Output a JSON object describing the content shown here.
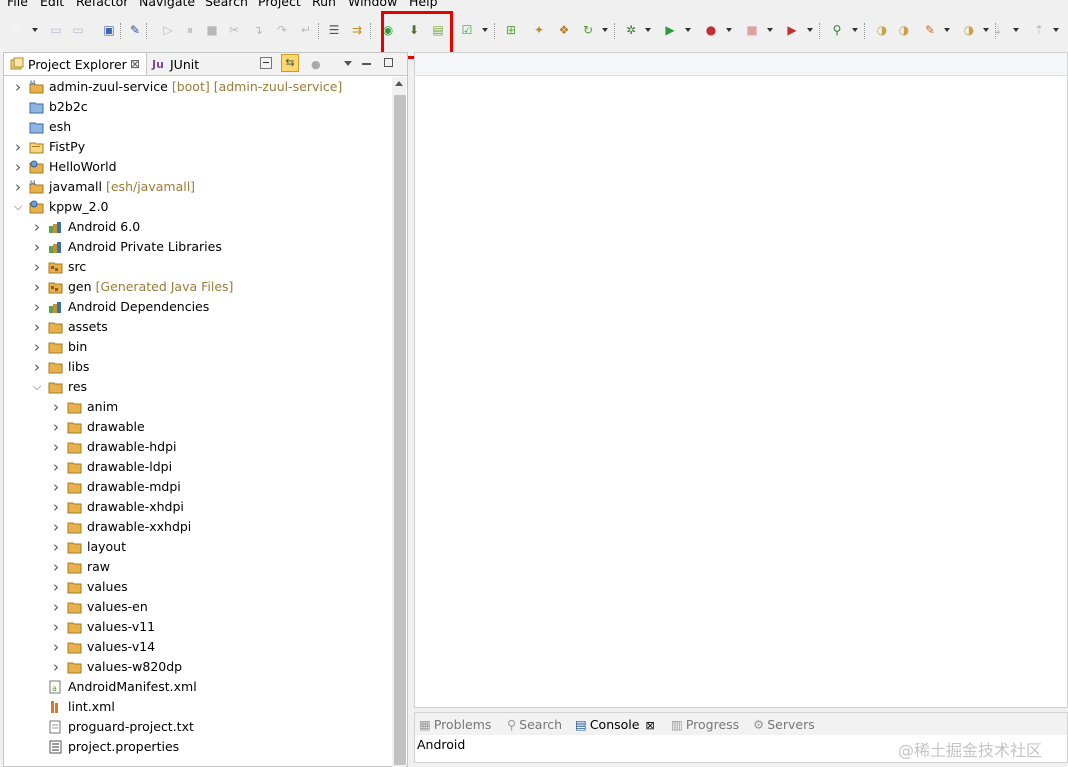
{
  "menu": [
    "File",
    "Edit",
    "Refactor",
    "Navigate",
    "Search",
    "Project",
    "Run",
    "Window",
    "Help"
  ],
  "explorer": {
    "tab_project_explorer": "Project Explorer",
    "tab_close_glyph": "⊠",
    "tab_junit": "JUnit",
    "tab_junit_prefix": "Ju"
  },
  "tree": [
    {
      "label": "admin-zuul-service",
      "deco": "[boot] [admin-zuul-service]",
      "icon": "maven-project-icon",
      "level": 0,
      "state": "collapsed"
    },
    {
      "label": "b2b2c",
      "deco": "",
      "icon": "closed-project-icon",
      "level": 0,
      "state": "none"
    },
    {
      "label": "esh",
      "deco": "",
      "icon": "closed-project-icon",
      "level": 0,
      "state": "none"
    },
    {
      "label": "FistPy",
      "deco": "",
      "icon": "project-folder-icon",
      "level": 0,
      "state": "collapsed"
    },
    {
      "label": "HelloWorld",
      "deco": "",
      "icon": "java-project-icon",
      "level": 0,
      "state": "collapsed"
    },
    {
      "label": "javamall",
      "deco": "[esh/javamall]",
      "icon": "maven-project-icon",
      "level": 0,
      "state": "collapsed"
    },
    {
      "label": "kppw_2.0",
      "deco": "",
      "icon": "java-project-icon",
      "level": 0,
      "state": "expanded"
    },
    {
      "label": "Android 6.0",
      "deco": "",
      "icon": "library-icon",
      "level": 1,
      "state": "collapsed"
    },
    {
      "label": "Android Private Libraries",
      "deco": "",
      "icon": "library-icon",
      "level": 1,
      "state": "collapsed"
    },
    {
      "label": "src",
      "deco": "",
      "icon": "source-folder-icon",
      "level": 1,
      "state": "collapsed"
    },
    {
      "label": "gen",
      "deco": "[Generated Java Files]",
      "icon": "source-folder-icon",
      "level": 1,
      "state": "collapsed"
    },
    {
      "label": "Android Dependencies",
      "deco": "",
      "icon": "library-icon",
      "level": 1,
      "state": "collapsed"
    },
    {
      "label": "assets",
      "deco": "",
      "icon": "folder-icon",
      "level": 1,
      "state": "collapsed"
    },
    {
      "label": "bin",
      "deco": "",
      "icon": "folder-icon",
      "level": 1,
      "state": "collapsed"
    },
    {
      "label": "libs",
      "deco": "",
      "icon": "folder-icon",
      "level": 1,
      "state": "collapsed"
    },
    {
      "label": "res",
      "deco": "",
      "icon": "folder-icon",
      "level": 1,
      "state": "expanded"
    },
    {
      "label": "anim",
      "deco": "",
      "icon": "folder-icon",
      "level": 2,
      "state": "collapsed"
    },
    {
      "label": "drawable",
      "deco": "",
      "icon": "folder-icon",
      "level": 2,
      "state": "collapsed"
    },
    {
      "label": "drawable-hdpi",
      "deco": "",
      "icon": "folder-icon",
      "level": 2,
      "state": "collapsed"
    },
    {
      "label": "drawable-ldpi",
      "deco": "",
      "icon": "folder-icon",
      "level": 2,
      "state": "collapsed"
    },
    {
      "label": "drawable-mdpi",
      "deco": "",
      "icon": "folder-icon",
      "level": 2,
      "state": "collapsed"
    },
    {
      "label": "drawable-xhdpi",
      "deco": "",
      "icon": "folder-icon",
      "level": 2,
      "state": "collapsed"
    },
    {
      "label": "drawable-xxhdpi",
      "deco": "",
      "icon": "folder-icon",
      "level": 2,
      "state": "collapsed"
    },
    {
      "label": "layout",
      "deco": "",
      "icon": "folder-icon",
      "level": 2,
      "state": "collapsed"
    },
    {
      "label": "raw",
      "deco": "",
      "icon": "folder-icon",
      "level": 2,
      "state": "collapsed"
    },
    {
      "label": "values",
      "deco": "",
      "icon": "folder-icon",
      "level": 2,
      "state": "collapsed"
    },
    {
      "label": "values-en",
      "deco": "",
      "icon": "folder-icon",
      "level": 2,
      "state": "collapsed"
    },
    {
      "label": "values-v11",
      "deco": "",
      "icon": "folder-icon",
      "level": 2,
      "state": "collapsed"
    },
    {
      "label": "values-v14",
      "deco": "",
      "icon": "folder-icon",
      "level": 2,
      "state": "collapsed"
    },
    {
      "label": "values-w820dp",
      "deco": "",
      "icon": "folder-icon",
      "level": 2,
      "state": "collapsed"
    },
    {
      "label": "AndroidManifest.xml",
      "deco": "",
      "icon": "android-manifest-icon",
      "level": 1,
      "state": "none"
    },
    {
      "label": "lint.xml",
      "deco": "",
      "icon": "xml-file-icon",
      "level": 1,
      "state": "none"
    },
    {
      "label": "proguard-project.txt",
      "deco": "",
      "icon": "text-file-icon",
      "level": 1,
      "state": "none"
    },
    {
      "label": "project.properties",
      "deco": "",
      "icon": "properties-file-icon",
      "level": 1,
      "state": "none"
    }
  ],
  "bottom": {
    "tabs": [
      "Problems",
      "Search",
      "Console",
      "Progress",
      "Servers"
    ],
    "console_text": "Android",
    "close_glyph": "⊠"
  },
  "watermark": "@稀土掘金技术社区",
  "colors": {
    "highlight": "#e60000",
    "decoration": "#9b7b38",
    "folder": "#e8b04a"
  }
}
